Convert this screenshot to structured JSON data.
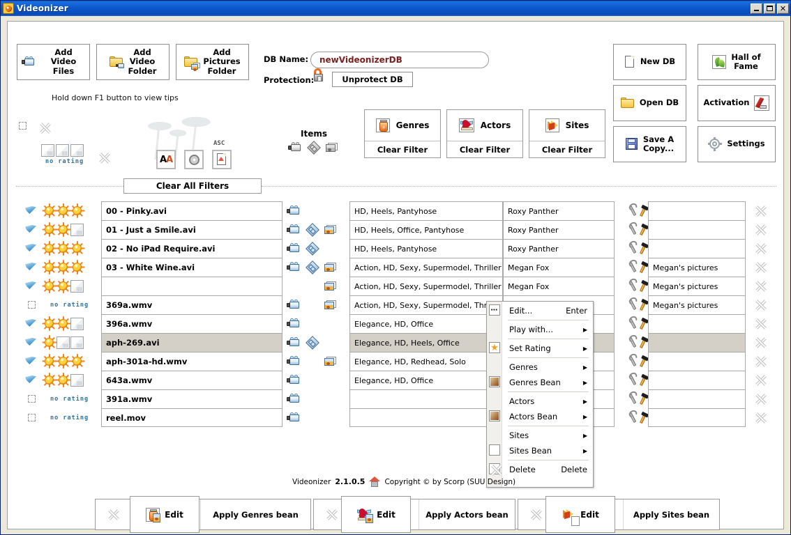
{
  "window": {
    "title": "Videonizer",
    "icon": "app-icon",
    "buttons": {
      "minimize": "_",
      "maximize": "□",
      "close": "✕"
    }
  },
  "toolbar": {
    "add_video_files": "Add Video\nFiles",
    "add_video_folder": "Add\nVideo\nFolder",
    "add_pictures_folder": "Add\nPictures\nFolder",
    "tip": "Hold down F1 button to view tips",
    "db_name_label": "DB Name:",
    "db_name_value": "newVideonizerDB",
    "protection_label": "Protection:",
    "unprotect": "Unprotect DB",
    "new_db": "New DB",
    "open_db": "Open DB",
    "save_a_copy": "Save A\nCopy...",
    "hall_of_fame": "Hall of\nFame",
    "activation": "Activation",
    "settings": "Settings"
  },
  "filters": {
    "items_label": "Items",
    "sort_asc_label": "ASC",
    "clear_all": "Clear All Filters",
    "no_rating": "no  rating",
    "boxes": [
      {
        "title": "Genres",
        "clear": "Clear Filter",
        "icon": "jar-icon"
      },
      {
        "title": "Actors",
        "clear": "Clear Filter",
        "icon": "heart-icon"
      },
      {
        "title": "Sites",
        "clear": "Clear Filter",
        "icon": "sites-icon"
      }
    ]
  },
  "table": {
    "rows": [
      {
        "checked": true,
        "rating": 3,
        "name": "00 - Pinky.avi",
        "media": [
          "video"
        ],
        "genres": "HD, Heels, Pantyhose",
        "actors": "Roxy Panther",
        "site": "",
        "selected": false
      },
      {
        "checked": true,
        "rating": 2,
        "name": "01 - Just a Smile.avi",
        "media": [
          "video",
          "film",
          "picture"
        ],
        "genres": "HD, Heels, Office, Pantyhose",
        "actors": "Roxy Panther",
        "site": "",
        "selected": false
      },
      {
        "checked": true,
        "rating": 3,
        "name": "02 - No iPad Require.avi",
        "media": [
          "video",
          "film"
        ],
        "genres": "HD, Heels, Pantyhose",
        "actors": "Roxy Panther",
        "site": "",
        "selected": false
      },
      {
        "checked": true,
        "rating": 3,
        "name": "03 - White Wine.avi",
        "media": [
          "video",
          "film",
          "picture"
        ],
        "genres": "Action, HD, Sexy, Supermodel, Thriller",
        "actors": "Megan Fox",
        "site": "Megan's pictures",
        "selected": false
      },
      {
        "checked": true,
        "rating": 2,
        "name": "",
        "media": [
          "picture"
        ],
        "genres": "Action, HD, Sexy, Supermodel, Thriller",
        "actors": "Megan Fox",
        "site": "Megan's pictures",
        "selected": false
      },
      {
        "checked": false,
        "rating": 0,
        "name": "369a.wmv",
        "media": [
          "video",
          "picture"
        ],
        "genres": "Action, HD, Sexy, Supermodel, Thriller",
        "actors": "",
        "site": "Megan's pictures",
        "selected": false
      },
      {
        "checked": true,
        "rating": 2,
        "name": "396a.wmv",
        "media": [
          "video"
        ],
        "genres": "Elegance, HD, Office",
        "actors": "",
        "site": "",
        "selected": false
      },
      {
        "checked": true,
        "rating": 1,
        "name": "aph-269.avi",
        "media": [
          "video",
          "film"
        ],
        "genres": "Elegance, HD, Heels, Office",
        "actors": "",
        "site": "",
        "selected": true
      },
      {
        "checked": true,
        "rating": 3,
        "name": "aph-301a-hd.wmv",
        "media": [
          "video",
          "picture"
        ],
        "genres": "Elegance, HD, Redhead, Solo",
        "actors": "",
        "site": "",
        "selected": false
      },
      {
        "checked": true,
        "rating": 2,
        "name": "643a.wmv",
        "media": [
          "video"
        ],
        "genres": "Elegance, HD, Office",
        "actors": "",
        "site": "",
        "selected": false
      },
      {
        "checked": false,
        "rating": 0,
        "name": "391a.wmv",
        "media": [
          "video"
        ],
        "genres": "",
        "actors": "",
        "site": "",
        "selected": false
      },
      {
        "checked": false,
        "rating": 0,
        "name": "reel.mov",
        "media": [
          "video"
        ],
        "genres": "",
        "actors": "",
        "site": "",
        "selected": false
      }
    ]
  },
  "context_menu": {
    "items": [
      {
        "label": "Edit...",
        "accel": "Enter",
        "submenu": false,
        "icon": "ellipsis-icon",
        "sep_after": true
      },
      {
        "label": "Play with...",
        "accel": "",
        "submenu": true,
        "icon": "",
        "sep_after": true
      },
      {
        "label": "Set Rating",
        "accel": "",
        "submenu": true,
        "icon": "star-icon",
        "sep_after": true
      },
      {
        "label": "Genres",
        "accel": "",
        "submenu": true,
        "icon": "",
        "sep_after": false
      },
      {
        "label": "Genres Bean",
        "accel": "",
        "submenu": true,
        "icon": "bean-icon",
        "sep_after": true
      },
      {
        "label": "Actors",
        "accel": "",
        "submenu": true,
        "icon": "",
        "sep_after": false
      },
      {
        "label": "Actors Bean",
        "accel": "",
        "submenu": true,
        "icon": "bean-icon",
        "sep_after": true
      },
      {
        "label": "Sites",
        "accel": "",
        "submenu": true,
        "icon": "",
        "sep_after": false
      },
      {
        "label": "Sites Bean",
        "accel": "",
        "submenu": true,
        "icon": "blank-icon",
        "sep_after": true
      },
      {
        "label": "Delete",
        "accel": "Delete",
        "submenu": false,
        "icon": "delete-icon",
        "sep_after": false
      }
    ]
  },
  "footer": {
    "app_name": "Videonizer",
    "version": "2.1.0.5",
    "copyright": "Copyright © by Scorp (SUU Design)",
    "groups": [
      {
        "edit": "Edit",
        "apply": "Apply Genres bean",
        "icon": "jar-icon"
      },
      {
        "edit": "Edit",
        "apply": "Apply Actors bean",
        "icon": "heart-icon"
      },
      {
        "edit": "Edit",
        "apply": "Apply Sites bean",
        "icon": "sites-icon"
      }
    ]
  },
  "colors": {
    "titlebar": "#0a4ab8",
    "db_name_text": "#7c2020",
    "selection": "#d4d0c8",
    "no_rating_text": "#2f6f9c"
  }
}
